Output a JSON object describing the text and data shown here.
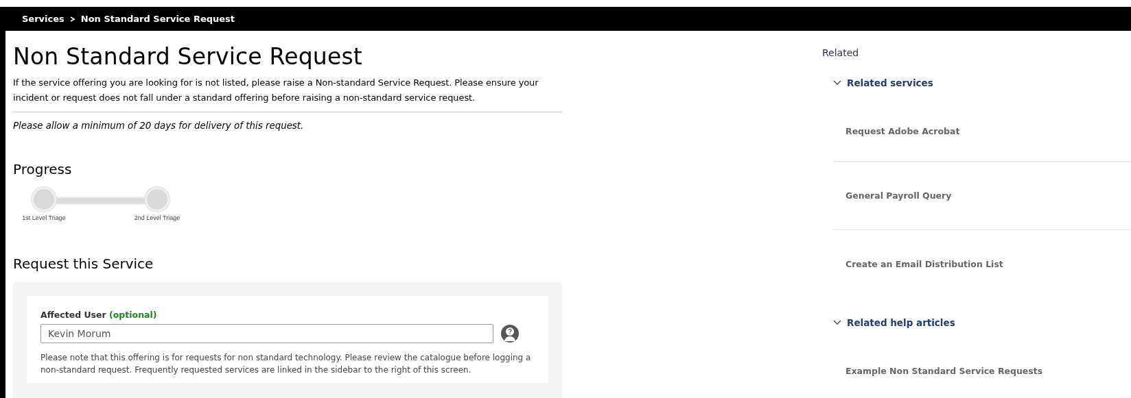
{
  "breadcrumb": [
    {
      "label": "Services"
    },
    {
      "label": "Non Standard Service Request"
    }
  ],
  "page": {
    "title": "Non Standard Service Request",
    "description": "If the service offering you are looking for is not listed, please raise a Non-standard Service Request. Please ensure your incident or request does not fall under a standard offering before raising a non-standard service request.",
    "delivery_note": "Please allow a minimum of 20 days for delivery of this request."
  },
  "progress": {
    "title": "Progress",
    "stages": [
      {
        "label": "1st Level Triage"
      },
      {
        "label": "2nd Level Triage"
      }
    ]
  },
  "request_form": {
    "title": "Request this Service",
    "fields": [
      {
        "label": "Affected User",
        "optional_tag": "(optional)",
        "value": "Kevin Morum",
        "note": "Please note that this offering is for requests for non standard technology. Please review the catalogue before logging a non-standard request. Frequently requested services are linked in the sidebar to the right of this screen."
      }
    ]
  },
  "related": {
    "title": "Related",
    "sections": [
      {
        "title": "Related services",
        "expanded": true,
        "items": [
          "Request Adobe Acrobat",
          "General Payroll Query",
          "Create an Email Distribution List"
        ]
      },
      {
        "title": "Related help articles",
        "expanded": true,
        "items": [
          "Example Non Standard Service Requests"
        ]
      }
    ]
  }
}
